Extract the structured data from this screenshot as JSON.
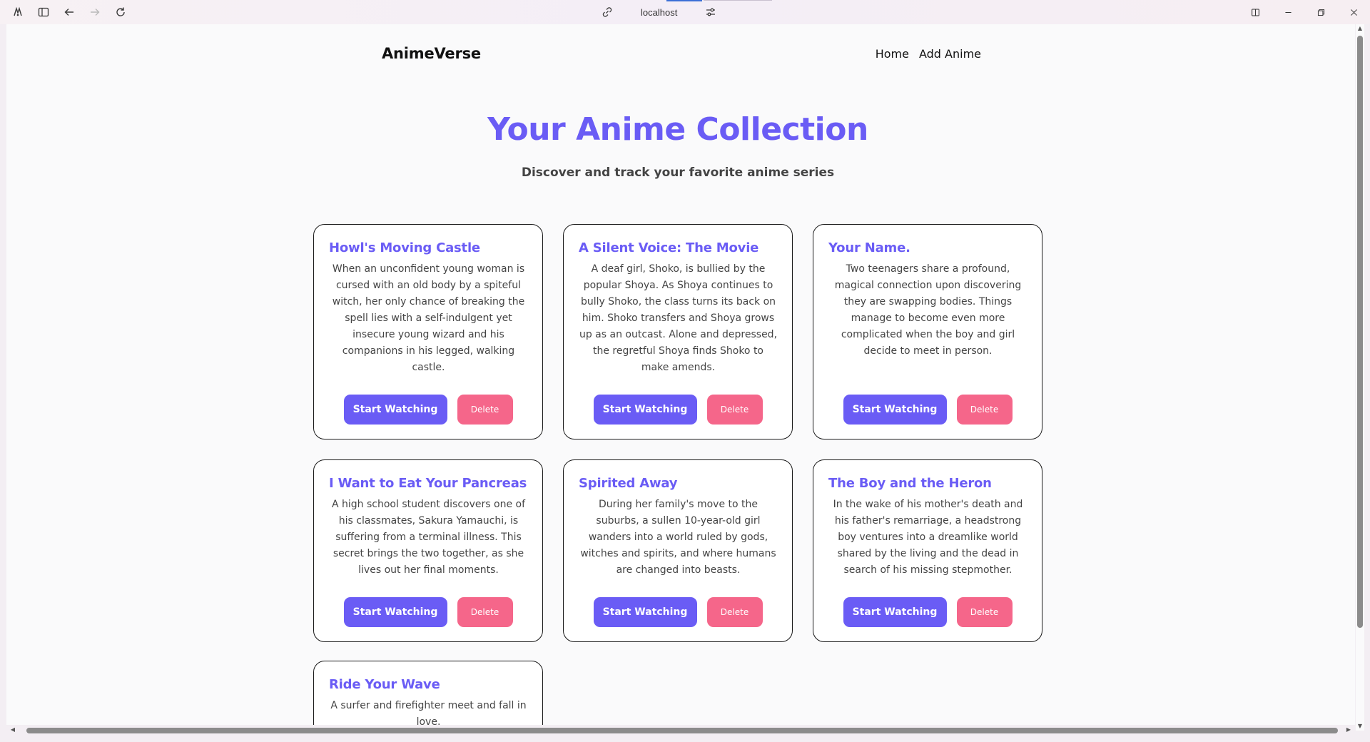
{
  "browser": {
    "url": "localhost",
    "icons": [
      "app-logo-icon",
      "sidebar-toggle-icon",
      "back-icon",
      "forward-icon",
      "reload-icon",
      "link-icon",
      "site-settings-icon",
      "split-view-icon",
      "minimize-icon",
      "maximize-icon",
      "close-icon"
    ]
  },
  "nav": {
    "brand": "AnimeVerse",
    "links": [
      "Home",
      "Add Anime"
    ]
  },
  "hero": {
    "title": "Your Anime Collection",
    "subtitle": "Discover and track your favorite anime series"
  },
  "cards": [
    {
      "title": "Howl's Moving Castle",
      "description": "When an unconfident young woman is cursed with an old body by a spiteful witch, her only chance of breaking the spell lies with a self-indulgent yet insecure young wizard and his companions in his legged, walking castle.",
      "watch_label": "Start Watching",
      "delete_label": "Delete"
    },
    {
      "title": "A Silent Voice: The Movie",
      "description": "A deaf girl, Shoko, is bullied by the popular Shoya. As Shoya continues to bully Shoko, the class turns its back on him. Shoko transfers and Shoya grows up as an outcast. Alone and depressed, the regretful Shoya finds Shoko to make amends.",
      "watch_label": "Start Watching",
      "delete_label": "Delete"
    },
    {
      "title": "Your Name.",
      "description": "Two teenagers share a profound, magical connection upon discovering they are swapping bodies. Things manage to become even more complicated when the boy and girl decide to meet in person.",
      "watch_label": "Start Watching",
      "delete_label": "Delete"
    },
    {
      "title": "I Want to Eat Your Pancreas",
      "description": "A high school student discovers one of his classmates, Sakura Yamauchi, is suffering from a terminal illness. This secret brings the two together, as she lives out her final moments.",
      "watch_label": "Start Watching",
      "delete_label": "Delete"
    },
    {
      "title": "Spirited Away",
      "description": "During her family's move to the suburbs, a sullen 10-year-old girl wanders into a world ruled by gods, witches and spirits, and where humans are changed into beasts.",
      "watch_label": "Start Watching",
      "delete_label": "Delete"
    },
    {
      "title": "The Boy and the Heron",
      "description": "In the wake of his mother's death and his father's remarriage, a headstrong boy ventures into a dreamlike world shared by the living and the dead in search of his missing stepmother.",
      "watch_label": "Start Watching",
      "delete_label": "Delete"
    },
    {
      "title": "Ride Your Wave",
      "description": "A surfer and firefighter meet and fall in love."
    }
  ],
  "colors": {
    "accent": "#6a5cf5",
    "delete": "#f5668a",
    "card_border": "#1a1a1a"
  }
}
